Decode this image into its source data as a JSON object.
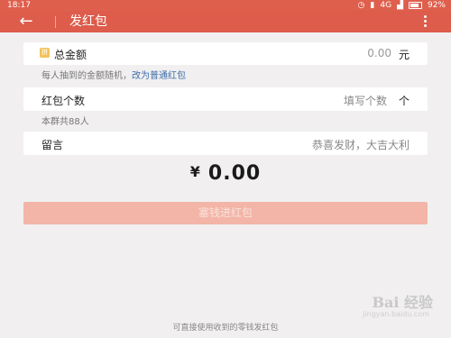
{
  "status": {
    "time": "18:17",
    "network": "4G",
    "battery": "92%"
  },
  "appbar": {
    "back_icon": "arrow-left-icon",
    "title": "发红包",
    "more_icon": "more-vertical-icon"
  },
  "total": {
    "badge": "拼",
    "label": "总金额",
    "value": "0.00",
    "unit": "元"
  },
  "hint": {
    "text": "每人抽到的金额随机，",
    "link": "改为普通红包"
  },
  "count": {
    "label": "红包个数",
    "placeholder": "填写个数",
    "unit": "个"
  },
  "group_info": "本群共88人",
  "message": {
    "label": "留言",
    "placeholder": "恭喜发财，大吉大利"
  },
  "amount": {
    "symbol": "¥",
    "value": "0.00"
  },
  "send_button": "塞钱进红包",
  "footer": "可直接使用收到的零钱发红包",
  "watermark": {
    "main": "Bai 经验",
    "sub": "jingyan.baidu.com"
  },
  "colors": {
    "header": "#dd5c4b",
    "button_disabled": "#f2b5a7",
    "link": "#3b6ea8",
    "badge": "#f2c35a"
  }
}
